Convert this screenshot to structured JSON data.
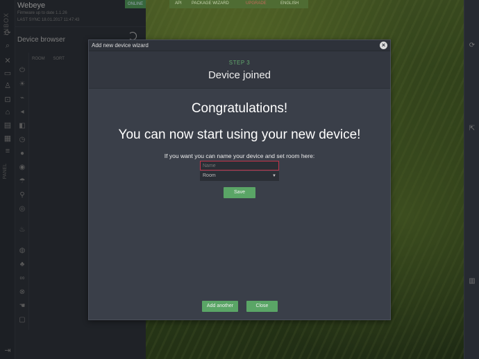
{
  "app": {
    "name": "Webeye",
    "firmware": "Firmware up to date 1.1.26",
    "last_sync": "LAST SYNC 18.01.2017 11:47:43",
    "status": "ONLINE",
    "rail_label": "INBOX",
    "rail_label2": "PANEL"
  },
  "top_menu": {
    "items": [
      "API",
      "PACKAGE WIZARD",
      "UPGRADE",
      "ENGLISH"
    ]
  },
  "device_browser": {
    "title": "Device browser",
    "tabs": [
      "ROOM",
      "SORT"
    ]
  },
  "dialog": {
    "title": "Add new device wizard",
    "step": "STEP 3",
    "heading": "Device joined",
    "congrats": "Congratulations!",
    "message": "You can now start using your new device!",
    "hint": "If you want you can name your device and set room here:",
    "name_placeholder": "Name",
    "room_value": "Room",
    "save_label": "Save",
    "add_another_label": "Add another",
    "close_label": "Close"
  },
  "colors": {
    "accent_green": "#5aa566",
    "error_border": "#c0344a",
    "dialog_bg": "#3a3f49"
  }
}
